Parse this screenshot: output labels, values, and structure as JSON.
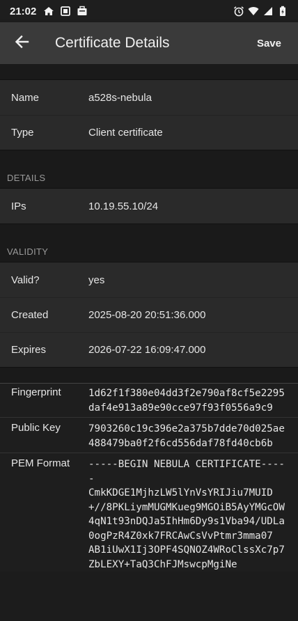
{
  "status_bar": {
    "time": "21:02",
    "left_icons": [
      "home-icon",
      "tablet-icon",
      "briefcase-icon"
    ],
    "right_icons": [
      "alarm-icon",
      "wifi-icon",
      "signal-icon",
      "battery-icon"
    ]
  },
  "app_bar": {
    "title": "Certificate Details",
    "save_label": "Save",
    "back_icon": "arrow-left-icon"
  },
  "basic": {
    "name_label": "Name",
    "name_value": "a528s-nebula",
    "type_label": "Type",
    "type_value": "Client certificate"
  },
  "details": {
    "header": "DETAILS",
    "ips_label": "IPs",
    "ips_value": "10.19.55.10/24"
  },
  "validity": {
    "header": "VALIDITY",
    "valid_label": "Valid?",
    "valid_value": "yes",
    "created_label": "Created",
    "created_value": "2025-08-20 20:51:36.000",
    "expires_label": "Expires",
    "expires_value": "2026-07-22 16:09:47.000"
  },
  "raw": {
    "fingerprint_label": "Fingerprint",
    "fingerprint_value": "1d62f1f380e04dd3f2e790af8cf5e2295daf4e913a89e90cce97f93f0556a9c9",
    "public_key_label": "Public Key",
    "public_key_value": "7903260c19c396e2a375b7dde70d025ae488479ba0f2f6cd556daf78fd40cb6b",
    "pem_label": "PEM Format",
    "pem_value": "-----BEGIN NEBULA CERTIFICATE-----\nCmkKDGE1MjhzLW5lYnVsYRIJiu7MUID+//8PKLiymMUGMKueg9MGOiB5AyYMGcOW\n4qN1t93nDQJa5IhHm6Dy9s1Vba94/UDLa0ogPzR4Z0xk7FRCAwCsVvPtmr3mma07\nAB1iUwX1Ij3OPF4SQNOZ4WRoClssXc7p7ZbLEXY+TaQ3ChFJMswcpMgiNe"
  }
}
